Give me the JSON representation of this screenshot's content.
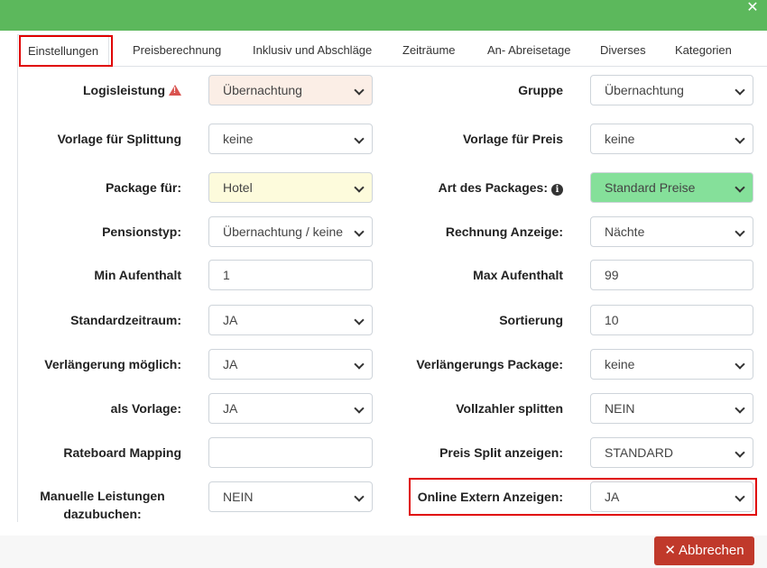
{
  "header": {
    "close_icon": "close-icon"
  },
  "tabs": [
    {
      "label": "Einstellungen",
      "active": true
    },
    {
      "label": "Preisberechnung"
    },
    {
      "label": "Inklusiv und Abschläge"
    },
    {
      "label": "Zeiträume"
    },
    {
      "label": "An- Abreisetage"
    },
    {
      "label": "Diverses"
    },
    {
      "label": "Kategorien"
    }
  ],
  "form": {
    "left": [
      {
        "label": "Logisleistung",
        "value": "Übernachtung",
        "type": "select",
        "icon": "warning-icon",
        "bg": "#fbeee6"
      },
      {
        "label": "Vorlage für Splittung",
        "value": "keine",
        "type": "select"
      },
      {
        "label": "Package für:",
        "value": "Hotel",
        "type": "select",
        "bg": "#fdfbdc"
      },
      {
        "label": "Pensionstyp:",
        "value": "Übernachtung / keine",
        "type": "select"
      },
      {
        "label": "Min Aufenthalt",
        "value": "1",
        "type": "input"
      },
      {
        "label": "Standardzeitraum:",
        "value": "JA",
        "type": "select"
      },
      {
        "label": "Verlängerung möglich:",
        "value": "JA",
        "type": "select"
      },
      {
        "label": "als Vorlage:",
        "value": "JA",
        "type": "select"
      },
      {
        "label": "Rateboard Mapping",
        "value": "",
        "type": "input"
      },
      {
        "label": "Manuelle Leistungen dazubuchen:",
        "value": "NEIN",
        "type": "select"
      }
    ],
    "right": [
      {
        "label": "Gruppe",
        "value": "Übernachtung",
        "type": "select"
      },
      {
        "label": "Vorlage für Preis",
        "value": "keine",
        "type": "select"
      },
      {
        "label": "Art des Packages:",
        "value": "Standard Preise",
        "type": "select",
        "icon": "info-icon",
        "bg": "#85e09a"
      },
      {
        "label": "Rechnung Anzeige:",
        "value": "Nächte",
        "type": "select"
      },
      {
        "label": "Max Aufenthalt",
        "value": "99",
        "type": "input"
      },
      {
        "label": "Sortierung",
        "value": "10",
        "type": "input"
      },
      {
        "label": "Verlängerungs Package:",
        "value": "keine",
        "type": "select"
      },
      {
        "label": "Vollzahler splitten",
        "value": "NEIN",
        "type": "select"
      },
      {
        "label": "Preis Split anzeigen:",
        "value": "STANDARD",
        "type": "select"
      },
      {
        "label": "Online Extern Anzeigen:",
        "value": "JA",
        "type": "select"
      }
    ]
  },
  "footer": {
    "cancel_label": "Abbrechen",
    "cancel_icon": "times-icon"
  },
  "colors": {
    "header": "#5cb85c",
    "cancel": "#c0392b",
    "highlight": "#e00000"
  }
}
